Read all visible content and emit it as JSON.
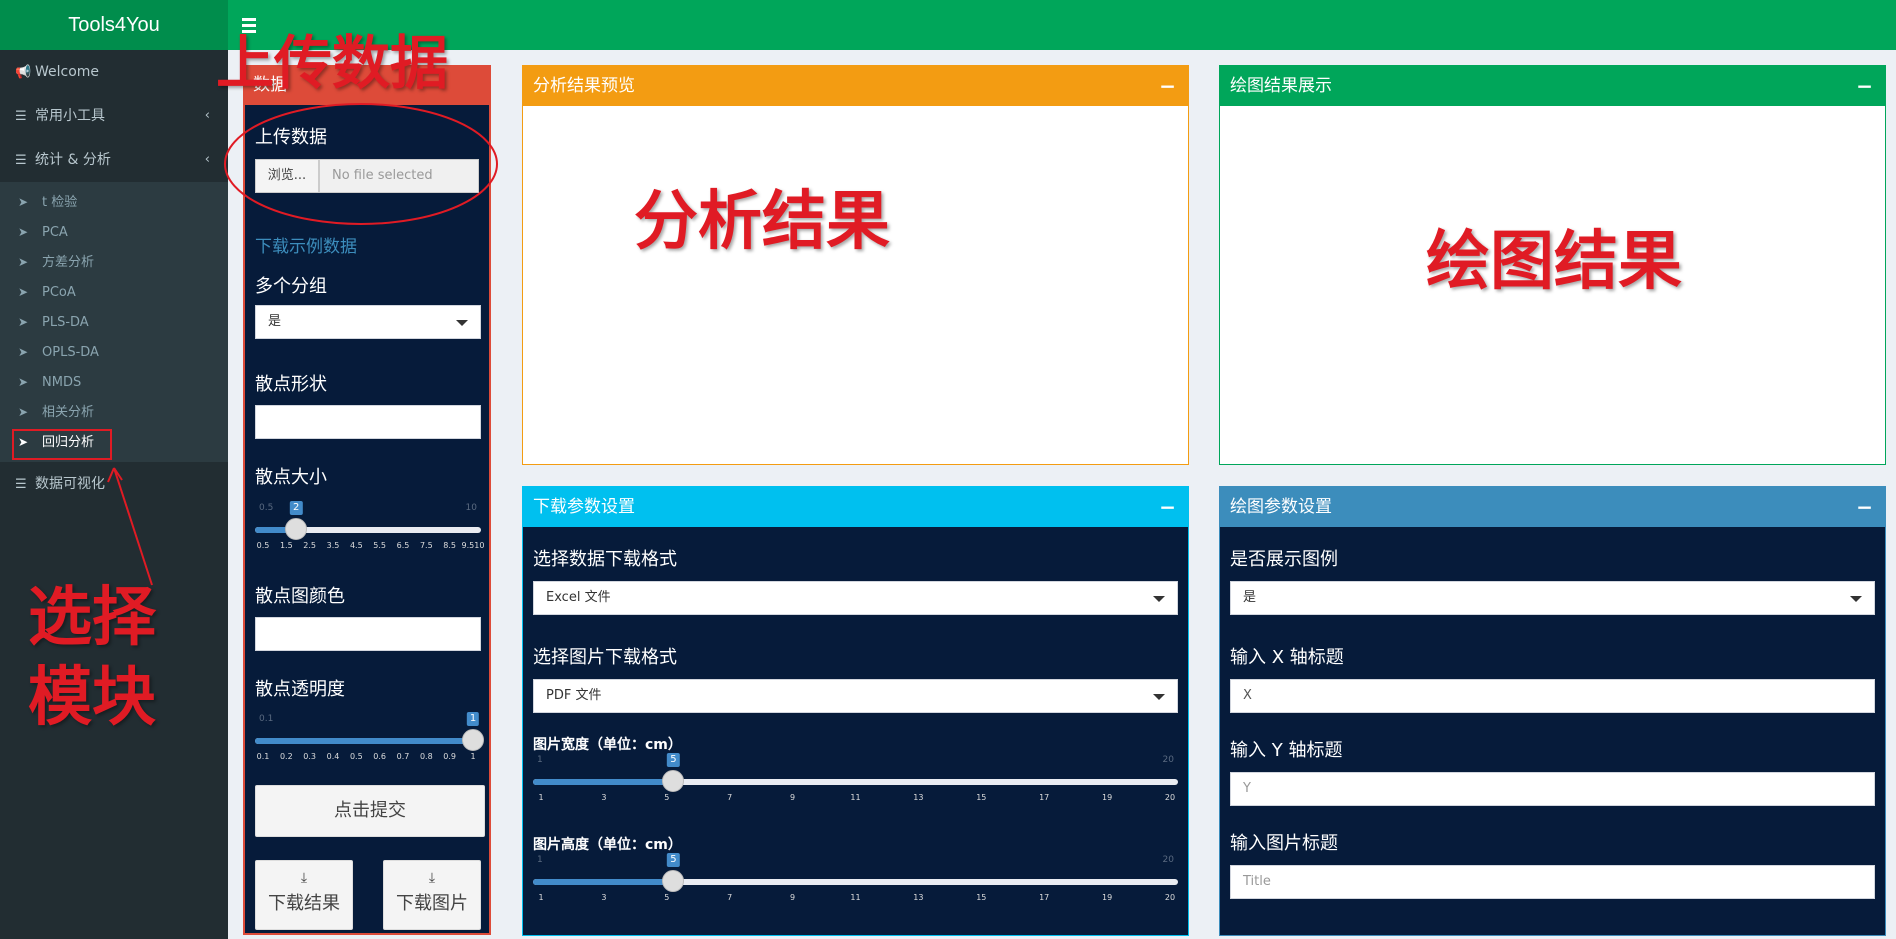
{
  "app": {
    "title": "Tools4You"
  },
  "sidebar": {
    "items": [
      {
        "label": "Welcome",
        "icon": "megaphone-icon"
      },
      {
        "label": "常用小工具",
        "icon": "list-icon"
      },
      {
        "label": "统计 & 分析",
        "icon": "list-icon"
      },
      {
        "label": "数据可视化",
        "icon": "list-icon"
      }
    ],
    "sub_items": [
      "t 检验",
      "PCA",
      "方差分析",
      "PCoA",
      "PLS-DA",
      "OPLS-DA",
      "NMDS",
      "相关分析",
      "回归分析"
    ],
    "active_sub": "回归分析"
  },
  "panels": {
    "data": {
      "title": "数据",
      "upload_label": "上传数据",
      "browse_label": "浏览...",
      "file_placeholder": "No file selected",
      "example_link": "下载示例数据",
      "multi_group_label": "多个分组",
      "multi_group_value": "是",
      "shape_label": "散点形状",
      "size_label": "散点大小",
      "size_slider": {
        "min": "0.5",
        "max": "10",
        "value": "2",
        "value_num": 2,
        "range": [
          0.5,
          10
        ],
        "ticks": [
          "0.5",
          "1.5",
          "2.5",
          "3.5",
          "4.5",
          "5.5",
          "6.5",
          "7.5",
          "8.5",
          "9.510"
        ]
      },
      "color_label": "散点图颜色",
      "alpha_label": "散点透明度",
      "alpha_slider": {
        "min": "0.1",
        "max": "1",
        "value": "1",
        "value_num": 1,
        "range": [
          0.1,
          1
        ],
        "ticks": [
          "0.1",
          "0.2",
          "0.3",
          "0.4",
          "0.5",
          "0.6",
          "0.7",
          "0.8",
          "0.9",
          "1"
        ]
      },
      "submit_label": "点击提交",
      "download_result_label": "下载结果",
      "download_image_label": "下载图片"
    },
    "analysis": {
      "title": "分析结果预览"
    },
    "plot": {
      "title": "绘图结果展示"
    },
    "download": {
      "title": "下载参数设置",
      "data_format_label": "选择数据下载格式",
      "data_format_value": "Excel 文件",
      "image_format_label": "选择图片下载格式",
      "image_format_value": "PDF 文件",
      "width_label": "图片宽度（单位：cm）",
      "width_slider": {
        "min": "1",
        "max": "20",
        "value": "5",
        "value_num": 5,
        "range": [
          1,
          20
        ],
        "ticks": [
          "1",
          "3",
          "5",
          "7",
          "9",
          "11",
          "13",
          "15",
          "17",
          "19",
          "20"
        ]
      },
      "height_label": "图片高度（单位：cm）",
      "height_slider": {
        "min": "1",
        "max": "20",
        "value": "5",
        "value_num": 5,
        "range": [
          1,
          20
        ],
        "ticks": [
          "1",
          "3",
          "5",
          "7",
          "9",
          "11",
          "13",
          "15",
          "17",
          "19",
          "20"
        ]
      }
    },
    "plot_params": {
      "title": "绘图参数设置",
      "legend_label": "是否展示图例",
      "legend_value": "是",
      "x_title_label": "输入 X 轴标题",
      "x_title_value": "X",
      "y_title_label": "输入 Y 轴标题",
      "y_title_placeholder": "Y",
      "fig_title_label": "输入图片标题",
      "fig_title_placeholder": "Title"
    }
  },
  "annotations": {
    "upload": "上传数据",
    "analysis": "分析结果",
    "plot": "绘图结果",
    "select_module_1": "选择",
    "select_module_2": "模块"
  },
  "colors": {
    "header": "#00a65a",
    "sidebar": "#222d32",
    "panel_dark": "#061b3a",
    "data_header": "#dd4b39",
    "analysis_header": "#f39c12",
    "plot_header": "#00a65a",
    "download_header": "#00c0ef",
    "plot_params_header": "#3c8dbc",
    "annotation": "#e01b24"
  }
}
